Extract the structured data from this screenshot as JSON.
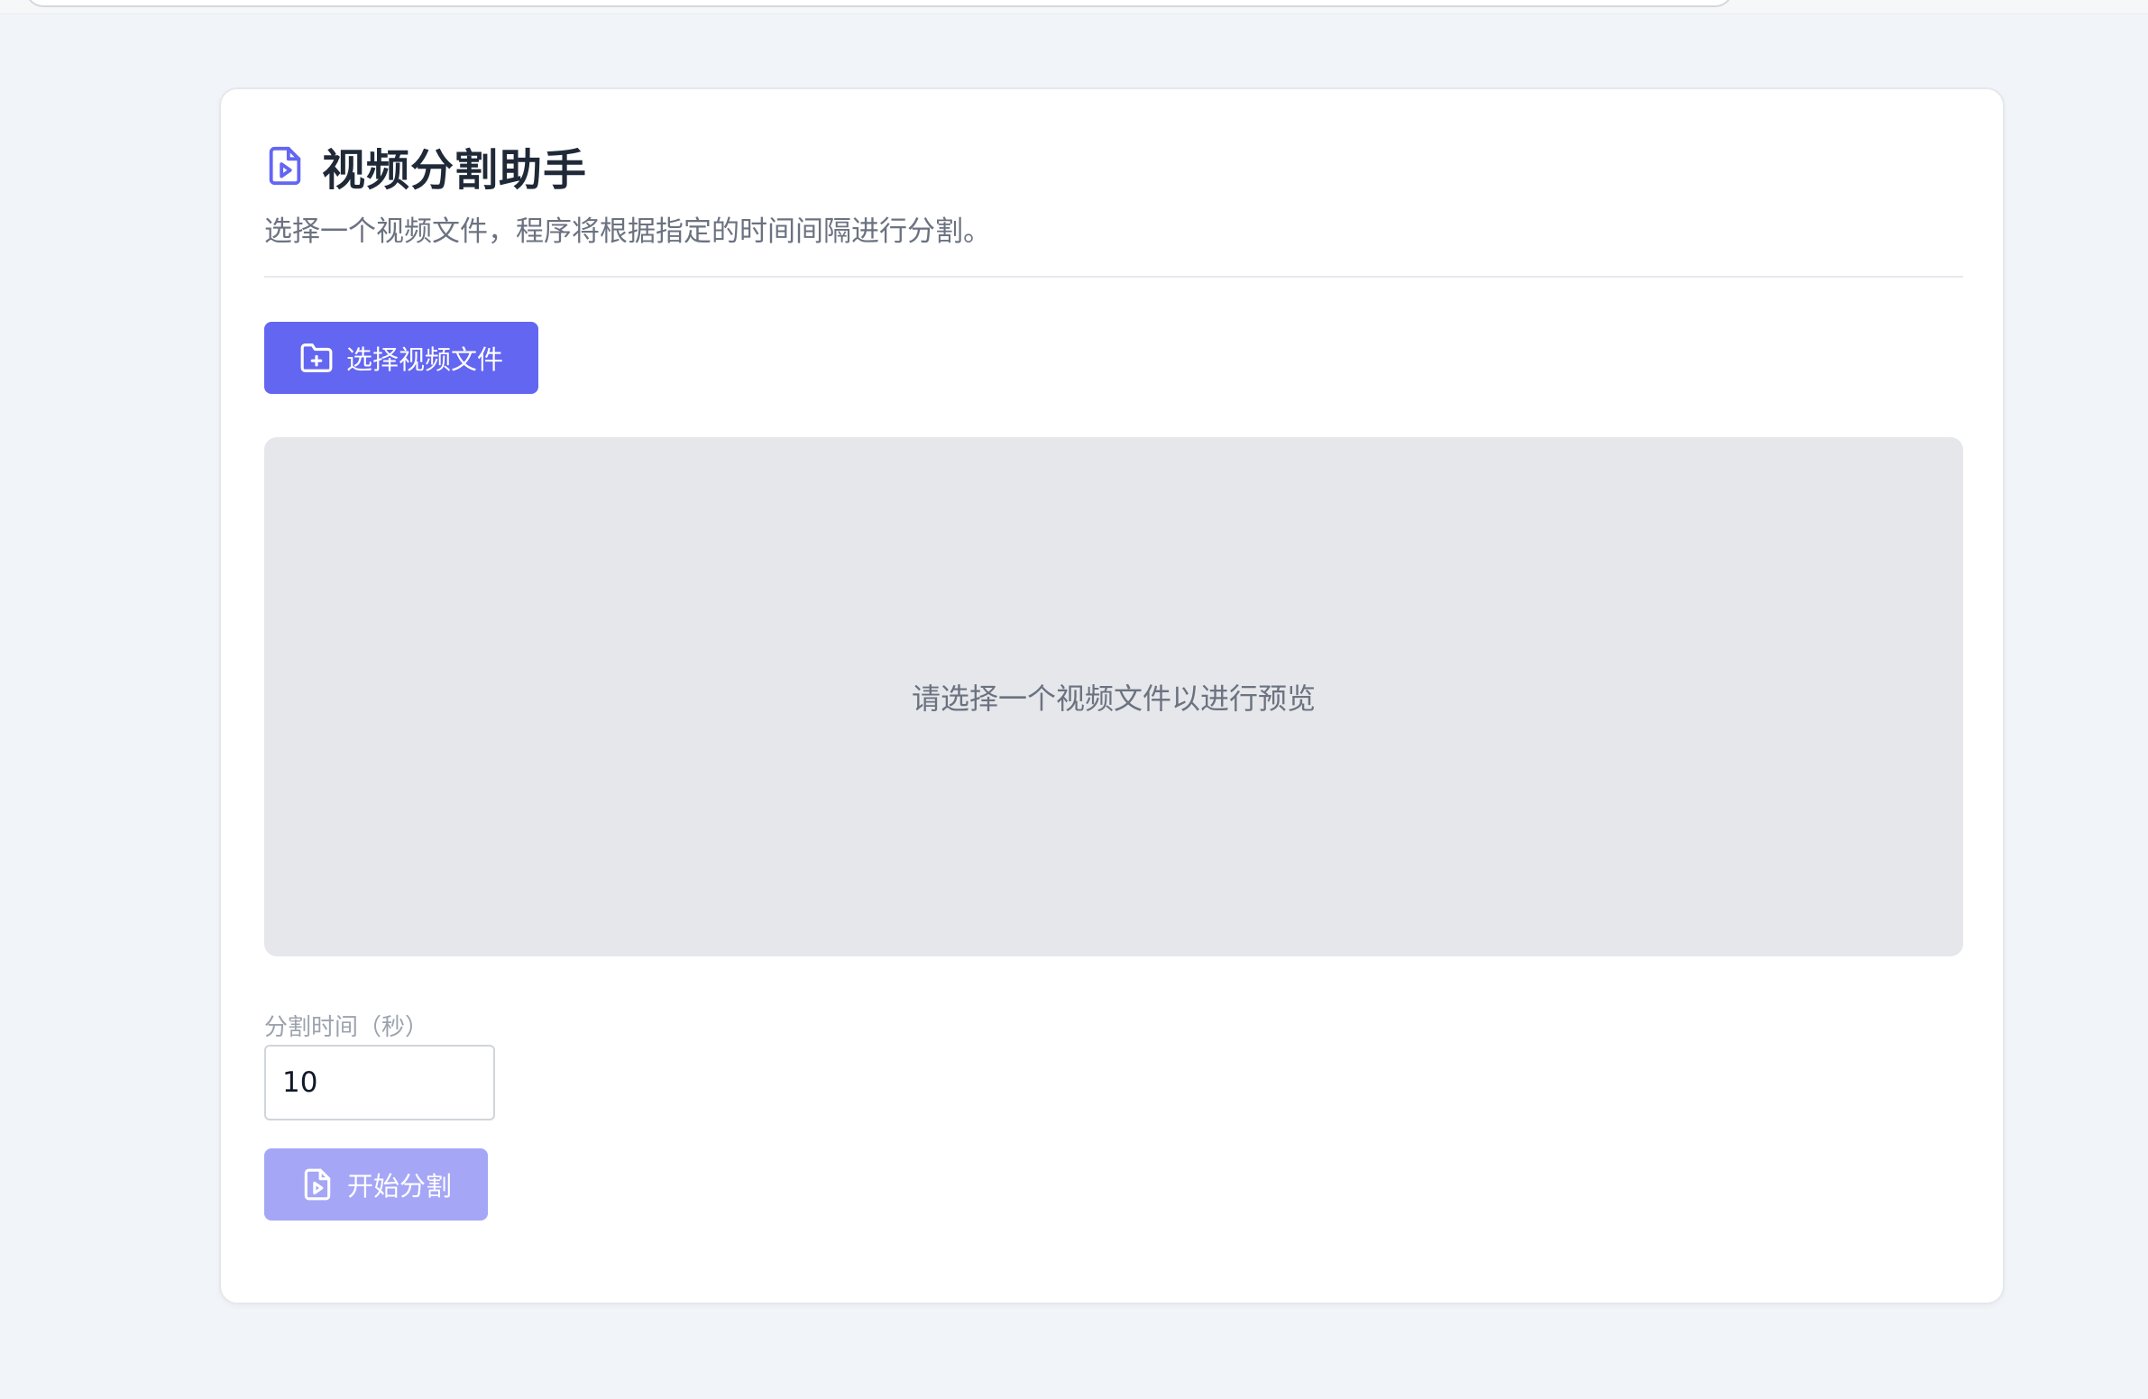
{
  "app": {
    "title": "视频分割助手",
    "subtitle": "选择一个视频文件，程序将根据指定的时间间隔进行分割。",
    "title_icon": "file-video-icon"
  },
  "actions": {
    "select_label": "选择视频文件",
    "select_icon": "folder-plus-icon",
    "start_label": "开始分割",
    "start_icon": "file-video-icon",
    "start_disabled": true
  },
  "preview": {
    "placeholder": "请选择一个视频文件以进行预览"
  },
  "split": {
    "label": "分割时间（秒）",
    "value": "10"
  },
  "colors": {
    "accent": "#6366f1",
    "accent_disabled": "#a5a6f6",
    "background": "#f1f4f8",
    "preview_bg": "#e5e7eb",
    "title_text": "#1f2937",
    "muted_text": "#6b7280"
  }
}
